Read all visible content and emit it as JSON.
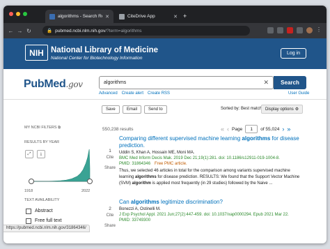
{
  "browser": {
    "tabs": [
      {
        "label": "algorithms - Search Results - P",
        "active": true
      },
      {
        "label": "CiteDrive App",
        "active": false
      }
    ],
    "url_host": "pubmed.ncbi.nlm.nih.gov",
    "url_path": "/?term=algorithms",
    "traffic_lights": [
      "#ff5f57",
      "#febc2e",
      "#28c840"
    ]
  },
  "nlm": {
    "logo_text": "NIH",
    "title": "National Library of Medicine",
    "subtitle": "National Center for Biotechnology Information",
    "login_label": "Log in"
  },
  "pubmed": {
    "logo_pub": "Pub",
    "logo_med": "Med",
    "logo_gov": ".gov",
    "search_value": "algorithms",
    "search_button": "Search",
    "links": [
      "Advanced",
      "Create alert",
      "Create RSS"
    ],
    "user_guide": "User Guide"
  },
  "toolbar": {
    "save": "Save",
    "email": "Email",
    "send_to": "Send to",
    "sort_text": "Sorted by: Best match",
    "display_options": "Display options"
  },
  "sidebar": {
    "filters_label": "MY NCBI FILTERS",
    "results_by_year": "RESULTS BY YEAR",
    "year_start": "1918",
    "year_end": "2022",
    "text_availability": "TEXT AVAILABILITY",
    "checkboxes": [
      "Abstract",
      "Free full text"
    ]
  },
  "results": {
    "count": "550,238 results",
    "page_label": "Page",
    "page_value": "1",
    "page_total": "of 55,024",
    "items": [
      {
        "num": "1",
        "title_pre": "Comparing different supervised machine learning ",
        "title_bold": "algorithms",
        "title_post": " for disease prediction.",
        "authors": "Uddin S, Khan A, Hossain ME, Moni MA.",
        "citation": "BMC Med Inform Decis Mak. 2019 Dec 21;19(1):281. doi: 10.1186/s12911-019-1004-8.",
        "pmid": "PMID: 31864346",
        "free": "Free PMC article.",
        "snippet_a": "Thus, we selected 46 articles in total for the comparison among variants supervised machine learning ",
        "snippet_b": "algorithms",
        "snippet_c": " for disease prediction. RESULTS: We found that the Support Vector Machine (SVM) ",
        "snippet_d": "algorithm",
        "snippet_e": " is applied most frequently (in 29 studies) followed by the Naive ..."
      },
      {
        "num": "2",
        "title_pre": "Can ",
        "title_bold": "algorithms",
        "title_post": " legitimize discrimination?",
        "authors": "Bonezzi A, Ostinelli M.",
        "citation": "J Exp Psychol Appl. 2021 Jun;27(2):447-459. doi: 10.1037/xap0000294. Epub 2021 Mar 22.",
        "pmid": "PMID: 33749300"
      }
    ],
    "cite_label": "Cite",
    "share_label": "Share"
  },
  "status_url": "https://pubmed.ncbi.nlm.nih.gov/31864346/",
  "chart_data": {
    "type": "area",
    "x": [
      1918,
      1930,
      1940,
      1950,
      1960,
      1970,
      1980,
      1990,
      2000,
      2005,
      2010,
      2015,
      2018,
      2020,
      2021,
      2022
    ],
    "values": [
      0,
      0,
      0,
      0,
      1,
      2,
      4,
      8,
      16,
      24,
      36,
      56,
      74,
      92,
      100,
      40
    ],
    "xlabel": "",
    "ylabel": ""
  }
}
